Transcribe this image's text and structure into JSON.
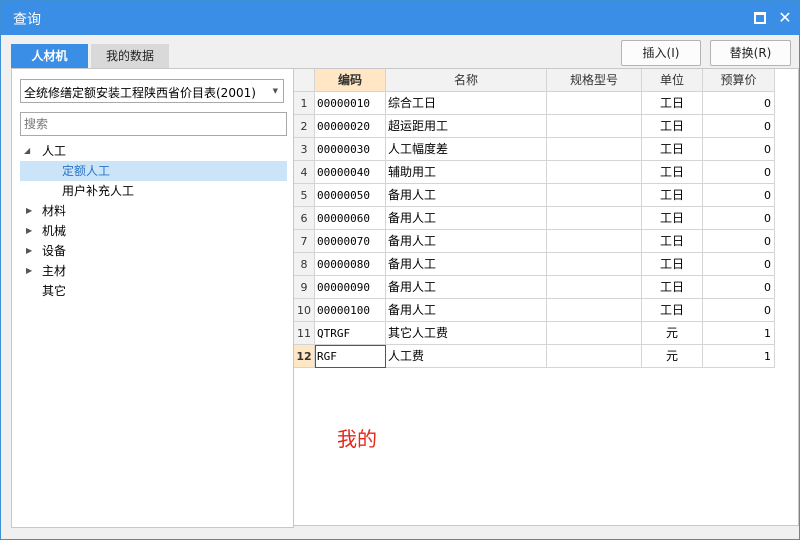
{
  "window": {
    "title": "查询"
  },
  "tabs": [
    {
      "label": "人材机"
    },
    {
      "label": "我的数据"
    }
  ],
  "toolbar": {
    "insert_label": "插入(I)",
    "replace_label": "替换(R)"
  },
  "left": {
    "select_value": "全统修缮定额安装工程陕西省价目表(2001)",
    "search_placeholder": "搜索",
    "tree": [
      {
        "label": "人工"
      },
      {
        "label": "定额人工"
      },
      {
        "label": "用户补充人工"
      },
      {
        "label": "材料"
      },
      {
        "label": "机械"
      },
      {
        "label": "设备"
      },
      {
        "label": "主材"
      },
      {
        "label": "其它"
      }
    ]
  },
  "grid": {
    "headers": [
      "编码",
      "名称",
      "规格型号",
      "单位",
      "预算价"
    ],
    "rows": [
      {
        "num": "1",
        "code": "00000010",
        "name": "综合工日",
        "spec": "",
        "unit": "工日",
        "price": "0"
      },
      {
        "num": "2",
        "code": "00000020",
        "name": "超运距用工",
        "spec": "",
        "unit": "工日",
        "price": "0"
      },
      {
        "num": "3",
        "code": "00000030",
        "name": "人工幅度差",
        "spec": "",
        "unit": "工日",
        "price": "0"
      },
      {
        "num": "4",
        "code": "00000040",
        "name": "辅助用工",
        "spec": "",
        "unit": "工日",
        "price": "0"
      },
      {
        "num": "5",
        "code": "00000050",
        "name": "备用人工",
        "spec": "",
        "unit": "工日",
        "price": "0"
      },
      {
        "num": "6",
        "code": "00000060",
        "name": "备用人工",
        "spec": "",
        "unit": "工日",
        "price": "0"
      },
      {
        "num": "7",
        "code": "00000070",
        "name": "备用人工",
        "spec": "",
        "unit": "工日",
        "price": "0"
      },
      {
        "num": "8",
        "code": "00000080",
        "name": "备用人工",
        "spec": "",
        "unit": "工日",
        "price": "0"
      },
      {
        "num": "9",
        "code": "00000090",
        "name": "备用人工",
        "spec": "",
        "unit": "工日",
        "price": "0"
      },
      {
        "num": "10",
        "code": "00000100",
        "name": "备用人工",
        "spec": "",
        "unit": "工日",
        "price": "0"
      },
      {
        "num": "11",
        "code": "QTRGF",
        "name": "其它人工费",
        "spec": "",
        "unit": "元",
        "price": "1"
      },
      {
        "num": "12",
        "code": "RGF",
        "name": "人工费",
        "spec": "",
        "unit": "元",
        "price": "1"
      }
    ]
  },
  "overlay_text": "我的"
}
